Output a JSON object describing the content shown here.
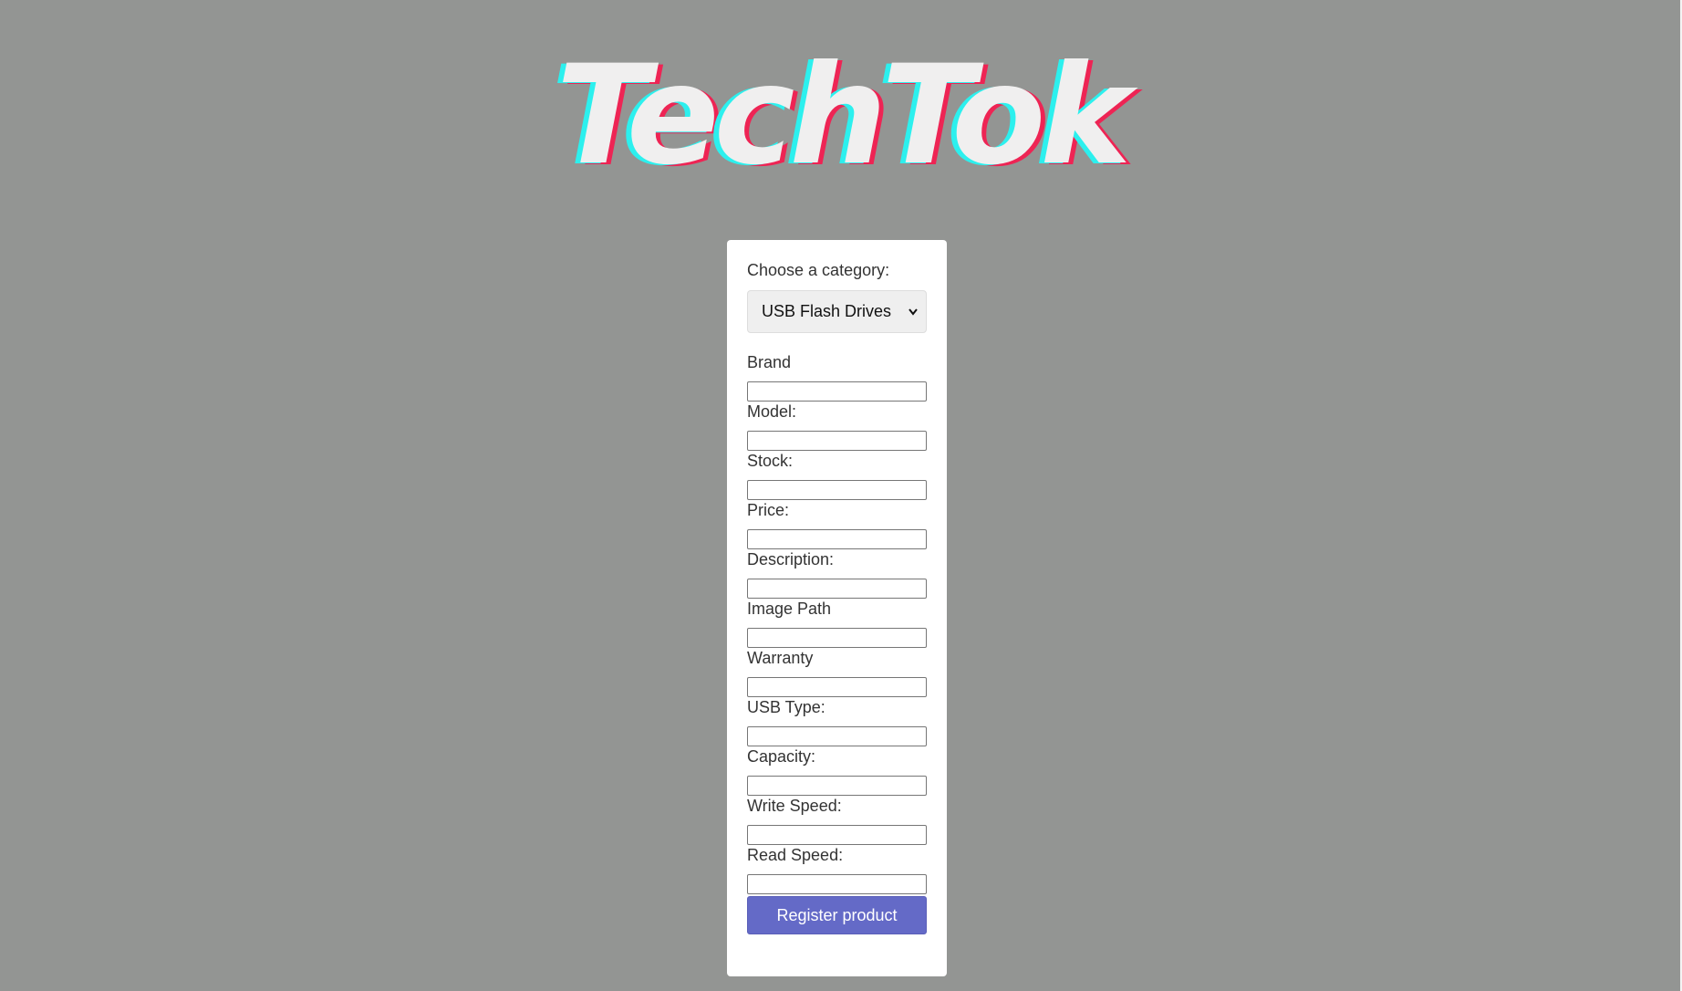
{
  "header": {
    "logo_text": "TechTok"
  },
  "form": {
    "category_label": "Choose a category:",
    "category_selected": "USB Flash Drives",
    "fields": [
      {
        "label": "Brand",
        "value": ""
      },
      {
        "label": "Model:",
        "value": ""
      },
      {
        "label": "Stock:",
        "value": ""
      },
      {
        "label": "Price:",
        "value": ""
      },
      {
        "label": "Description:",
        "value": ""
      },
      {
        "label": "Image Path",
        "value": ""
      },
      {
        "label": "Warranty",
        "value": ""
      },
      {
        "label": "USB Type:",
        "value": ""
      },
      {
        "label": "Capacity:",
        "value": ""
      },
      {
        "label": "Write Speed:",
        "value": ""
      },
      {
        "label": "Read Speed:",
        "value": ""
      }
    ],
    "submit_label": "Register product"
  },
  "colors": {
    "background": "#939593",
    "logo_fill": "#f0efef",
    "logo_shadow_cyan": "#2cf0ee",
    "logo_shadow_pink": "#ee2454",
    "button": "#646ac7"
  },
  "icons": {
    "select_arrow": "chevron-down-icon"
  }
}
